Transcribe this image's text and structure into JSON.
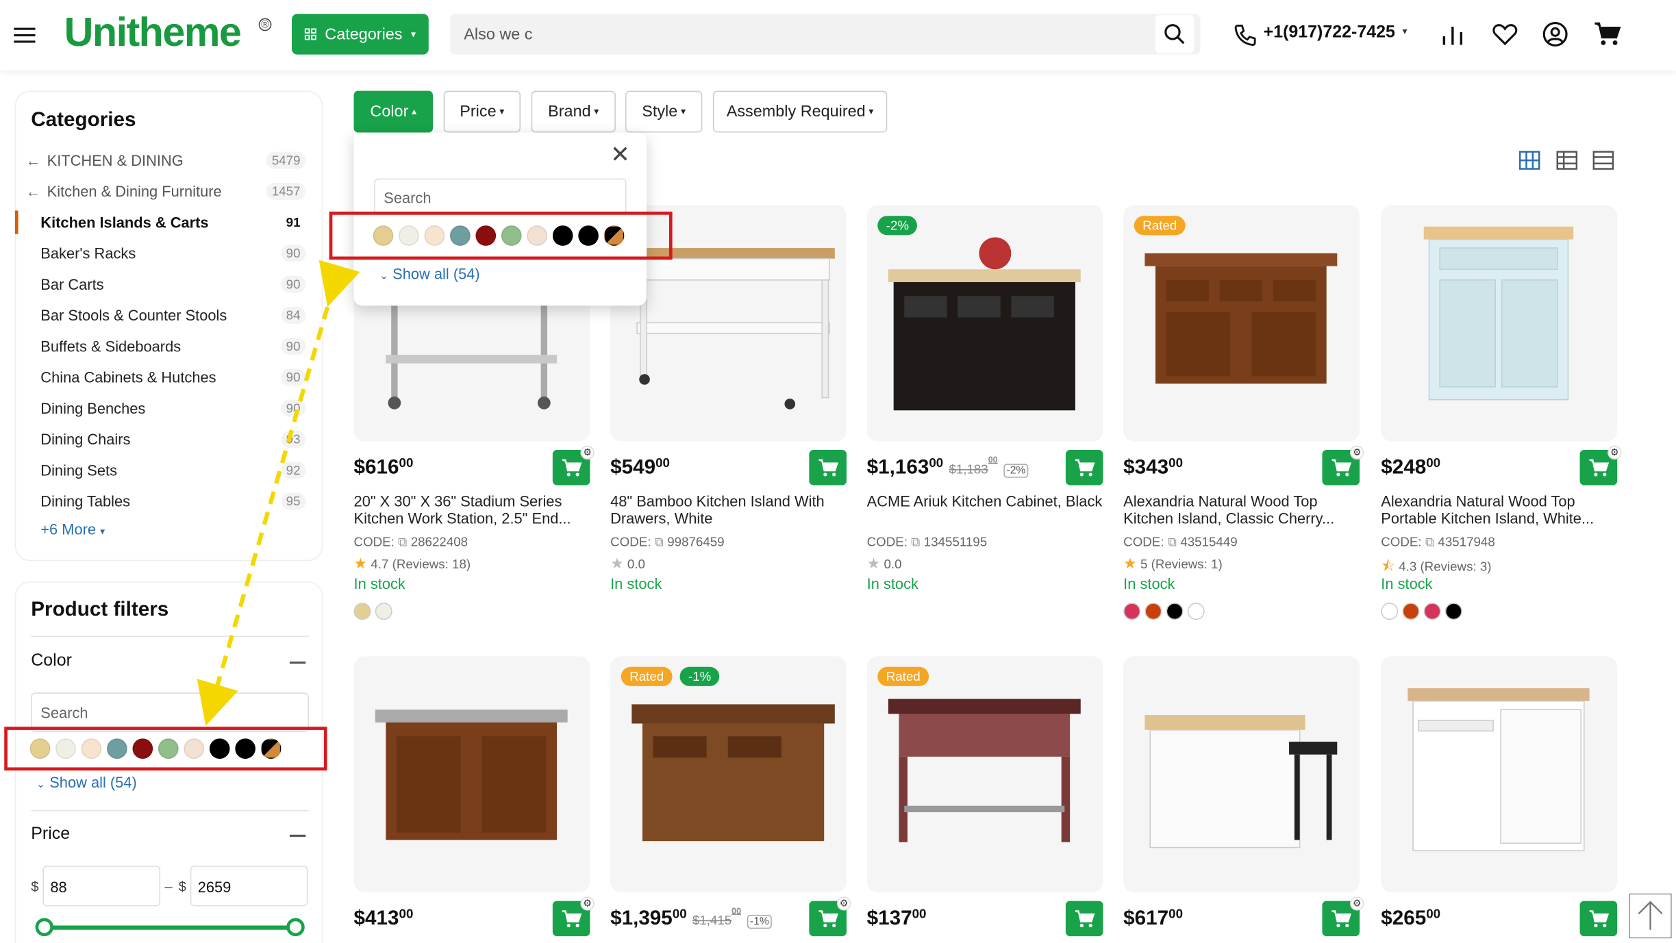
{
  "header": {
    "logo": "Unitheme",
    "categories_label": "Categories",
    "search_value": "Also we c",
    "phone": "+1(917)722-7425"
  },
  "sidebar": {
    "categories_title": "Categories",
    "parents": [
      {
        "label": "KITCHEN & DINING",
        "count": "5479"
      },
      {
        "label": "Kitchen & Dining Furniture",
        "count": "1457"
      }
    ],
    "items": [
      {
        "label": "Kitchen Islands & Carts",
        "count": "91",
        "active": true
      },
      {
        "label": "Baker's Racks",
        "count": "90"
      },
      {
        "label": "Bar Carts",
        "count": "90"
      },
      {
        "label": "Bar Stools & Counter Stools",
        "count": "84"
      },
      {
        "label": "Buffets & Sideboards",
        "count": "90"
      },
      {
        "label": "China Cabinets & Hutches",
        "count": "90"
      },
      {
        "label": "Dining Benches",
        "count": "90"
      },
      {
        "label": "Dining Chairs",
        "count": "93"
      },
      {
        "label": "Dining Sets",
        "count": "92"
      },
      {
        "label": "Dining Tables",
        "count": "95"
      }
    ],
    "more_label": "+6 More",
    "filters_title": "Product filters",
    "color_title": "Color",
    "color_search_placeholder": "Search",
    "show_all": "Show all (54)",
    "price_title": "Price",
    "currency": "$",
    "price_min": "88",
    "price_max": "2659",
    "dash": "–"
  },
  "swatch_colors": [
    "#e3cf8f",
    "#efefe6",
    "#f8e3cf",
    "#6f9ea0",
    "#8b0e0e",
    "#8fbe8a",
    "#f3e1d4",
    "#000000",
    "#000000",
    "split"
  ],
  "filter_bar": {
    "buttons": [
      "Color",
      "Price",
      "Brand",
      "Style",
      "Assembly Required"
    ]
  },
  "popup": {
    "search_placeholder": "Search",
    "show_all": "Show all (54)"
  },
  "products": [
    {
      "price": "$616",
      "cents": "00",
      "title": "20\" X 30\" X 36\" Stadium Series Kitchen Work Station, 2.5\" End...",
      "code": "28622408",
      "rating": "4.7 (Reviews: 18)",
      "star": "full",
      "stock": "In stock",
      "colors": [
        "#e3cf8f",
        "#efefe6"
      ]
    },
    {
      "price": "$549",
      "cents": "00",
      "title": "48\" Bamboo Kitchen Island With Drawers, White",
      "code": "99876459",
      "rating": "0.0",
      "star": "empty",
      "stock": "In stock",
      "colors": []
    },
    {
      "price": "$1,163",
      "cents": "00",
      "old": "$1,183",
      "old_cents": "00",
      "disc": "-2%",
      "title": "ACME Ariuk Kitchen Cabinet, Black",
      "code": "134551195",
      "rating": "0.0",
      "star": "empty",
      "stock": "In stock",
      "colors": [],
      "badges": [
        "-2%"
      ]
    },
    {
      "price": "$343",
      "cents": "00",
      "title": "Alexandria Natural Wood Top Kitchen Island, Classic Cherry...",
      "code": "43515449",
      "rating": "5 (Reviews: 1)",
      "star": "full",
      "stock": "In stock",
      "colors": [
        "#d6335a",
        "#c8410a",
        "#000000",
        "#ffffff"
      ],
      "badges": [
        "Rated"
      ]
    },
    {
      "price": "$248",
      "cents": "00",
      "title": "Alexandria Natural Wood Top Portable Kitchen Island, White...",
      "code": "43517948",
      "rating": "4.3 (Reviews: 3)",
      "star": "half",
      "stock": "In stock",
      "colors": [
        "#ffffff",
        "#c8410a",
        "#d6335a",
        "#000000"
      ]
    },
    {
      "price": "$413",
      "cents": "00"
    },
    {
      "price": "$1,395",
      "cents": "00",
      "old": "$1,415",
      "old_cents": "00",
      "disc": "-1%",
      "badges": [
        "Rated",
        "-1%"
      ]
    },
    {
      "price": "$137",
      "cents": "00",
      "badges": [
        "Rated"
      ]
    },
    {
      "price": "$617",
      "cents": "00"
    },
    {
      "price": "$265",
      "cents": "00"
    }
  ],
  "code_label": "CODE:"
}
